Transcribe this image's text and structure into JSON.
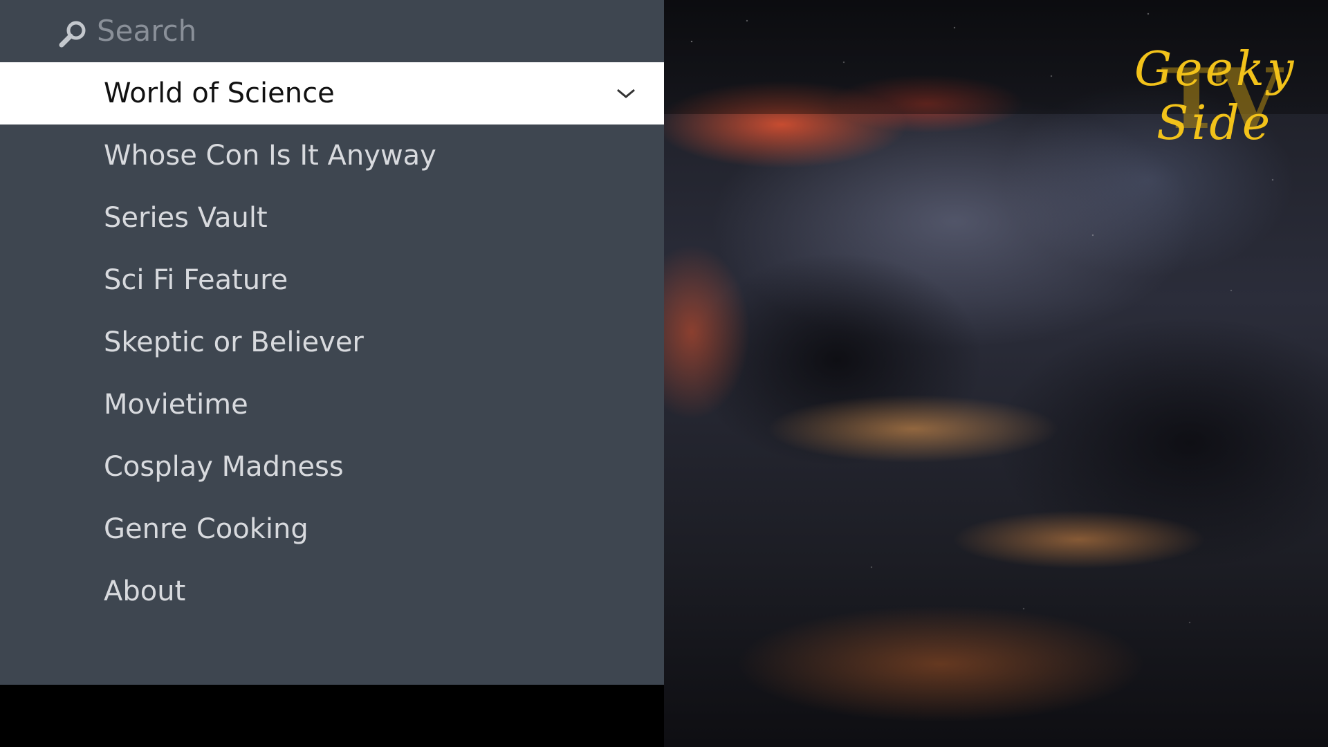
{
  "app": {
    "logo_line1": "Geeky",
    "logo_line2": "Side",
    "logo_mark": "TV",
    "accent_color": "#f2c21a"
  },
  "search": {
    "placeholder": "Search",
    "value": "",
    "icon": "search-icon"
  },
  "menu": {
    "selected_index": 0,
    "items": [
      {
        "label": "World of Science",
        "expand_icon": "chevron-down-icon"
      },
      {
        "label": "Whose Con Is It Anyway"
      },
      {
        "label": "Series Vault"
      },
      {
        "label": "Sci Fi Feature"
      },
      {
        "label": "Skeptic or Believer"
      },
      {
        "label": "Movietime"
      },
      {
        "label": "Cosplay Madness"
      },
      {
        "label": "Genre Cooking"
      },
      {
        "label": "About"
      }
    ]
  },
  "colors": {
    "panel_bg": "#3e4650",
    "selected_bg": "#ffffff",
    "item_text": "#d8dade",
    "selected_text": "#111111"
  }
}
